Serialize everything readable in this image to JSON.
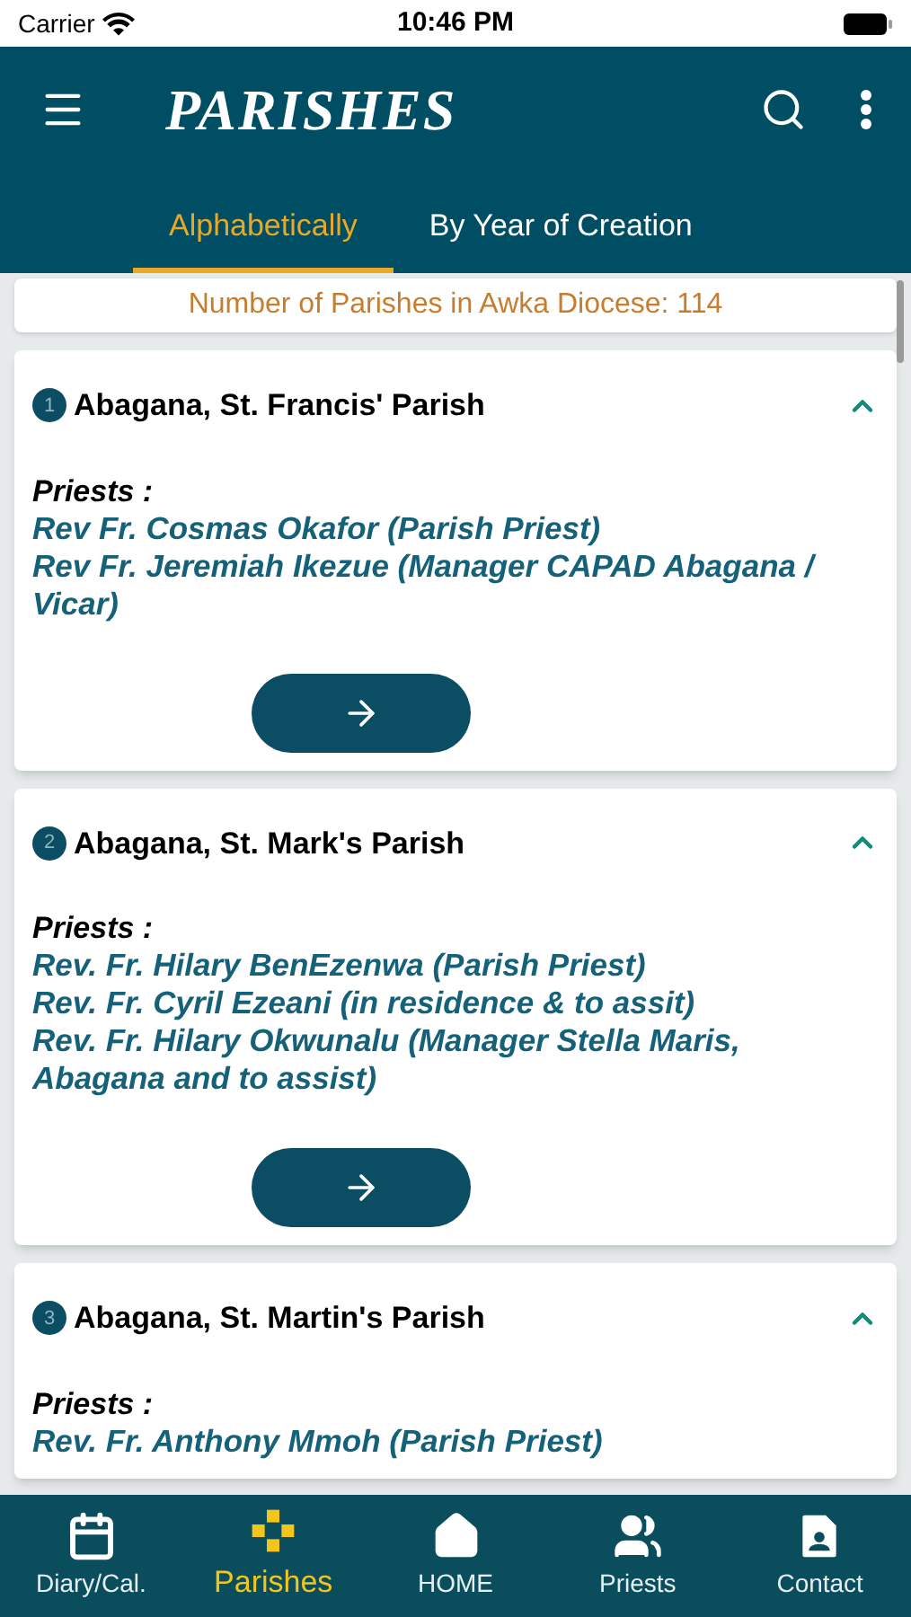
{
  "status_bar": {
    "carrier": "Carrier",
    "time": "10:46 PM"
  },
  "app_bar": {
    "title": "PARISHES"
  },
  "tabs": [
    {
      "label": "Alphabetically",
      "selected": true
    },
    {
      "label": "By Year of Creation",
      "selected": false
    }
  ],
  "count_banner": "Number of Parishes in Awka Diocese: 114",
  "parishes": [
    {
      "number": "1",
      "name": "Abagana, St. Francis' Parish",
      "expanded": true,
      "priests_label": "Priests :",
      "priests": [
        "Rev Fr. Cosmas Okafor (Parish Priest)",
        "Rev Fr. Jeremiah Ikezue (Manager CAPAD Abagana / Vicar)"
      ]
    },
    {
      "number": "2",
      "name": "Abagana, St. Mark's Parish",
      "expanded": true,
      "priests_label": "Priests :",
      "priests": [
        "Rev. Fr. Hilary BenEzenwa (Parish Priest)",
        "Rev. Fr. Cyril Ezeani (in residence & to assit)",
        "Rev. Fr. Hilary Okwunalu (Manager Stella Maris, Abagana and to assist)"
      ]
    },
    {
      "number": "3",
      "name": "Abagana, St. Martin's Parish",
      "expanded": true,
      "priests_label": "Priests :",
      "priests": [
        "Rev. Fr. Anthony Mmoh (Parish Priest)"
      ]
    }
  ],
  "bottom_nav": [
    {
      "label": "Diary/Cal.",
      "selected": false
    },
    {
      "label": "Parishes",
      "selected": true
    },
    {
      "label": "HOME",
      "selected": false
    },
    {
      "label": "Priests",
      "selected": false
    },
    {
      "label": "Contact",
      "selected": false
    }
  ]
}
